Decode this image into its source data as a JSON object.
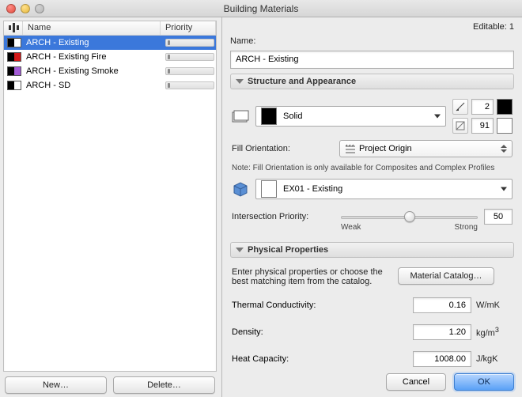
{
  "window": {
    "title": "Building Materials"
  },
  "left": {
    "headers": {
      "name": "Name",
      "priority": "Priority"
    },
    "items": [
      {
        "name": "ARCH - Existing",
        "color1": "#000000",
        "color2": "#ffffff",
        "selected": true
      },
      {
        "name": "ARCH - Existing Fire",
        "color1": "#000000",
        "color2": "#d11a1a",
        "selected": false
      },
      {
        "name": "ARCH - Existing Smoke",
        "color1": "#000000",
        "color2": "#a35bd6",
        "selected": false
      },
      {
        "name": "ARCH - SD",
        "color1": "#000000",
        "color2": "#ffffff",
        "selected": false
      }
    ],
    "buttons": {
      "new": "New…",
      "delete": "Delete…"
    }
  },
  "right": {
    "editable_label": "Editable: 1",
    "name_label": "Name:",
    "name_value": "ARCH - Existing",
    "section_structure": "Structure and Appearance",
    "fill_name": "Solid",
    "pen_fg_value": "2",
    "pen_bg_value": "91",
    "fill_orientation_label": "Fill Orientation:",
    "fill_orientation_value": "Project Origin",
    "note": "Note: Fill Orientation is only available for Composites and Complex Profiles",
    "surface_name": "EX01 - Existing",
    "intersection_label": "Intersection Priority:",
    "intersection_weak": "Weak",
    "intersection_strong": "Strong",
    "intersection_value": "50",
    "section_physical": "Physical Properties",
    "phys_hint": "Enter physical properties or choose the best matching item from the catalog.",
    "catalog_btn": "Material Catalog…",
    "thermal_label": "Thermal Conductivity:",
    "thermal_value": "0.16",
    "thermal_unit": "W/mK",
    "density_label": "Density:",
    "density_value": "1.20",
    "density_unit_html": "kg/m³",
    "heat_label": "Heat Capacity:",
    "heat_value": "1008.00",
    "heat_unit": "J/kgK",
    "cancel": "Cancel",
    "ok": "OK"
  }
}
